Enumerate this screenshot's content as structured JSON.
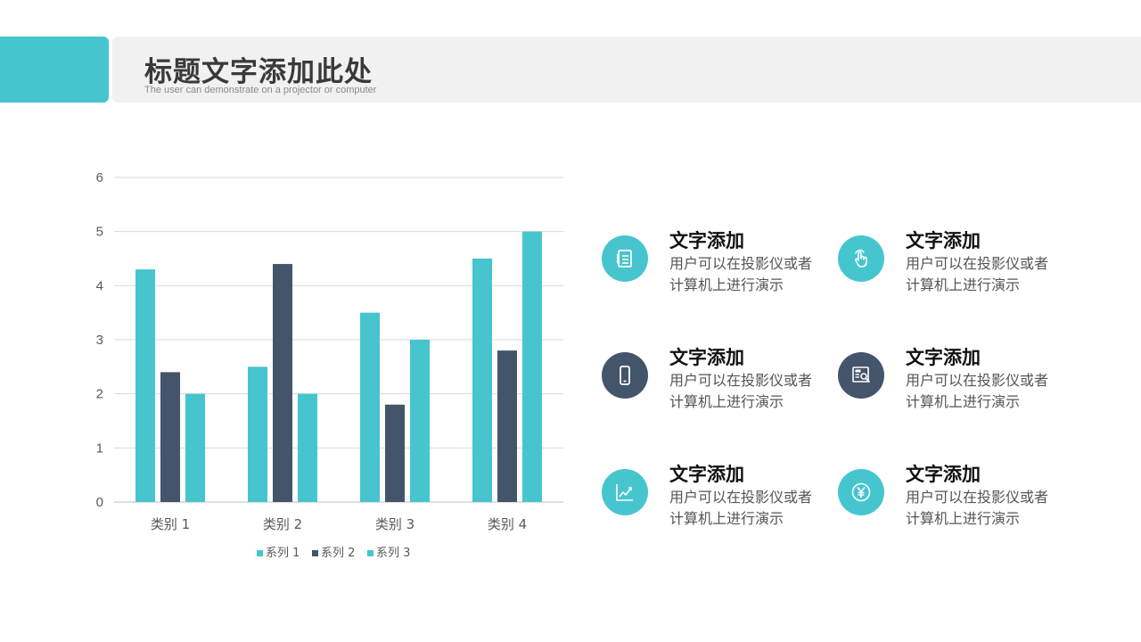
{
  "header": {
    "title": "标题文字添加此处",
    "subtitle": "The user can demonstrate on a projector or computer"
  },
  "colors": {
    "accent": "#47c5cf",
    "dark": "#44546a",
    "title_bar": "#f1f1f1"
  },
  "chart_data": {
    "type": "bar",
    "categories": [
      "类别 1",
      "类别 2",
      "类别 3",
      "类别 4"
    ],
    "series": [
      {
        "name": "系列 1",
        "values": [
          4.3,
          2.5,
          3.5,
          4.5
        ],
        "color": "#47c5cf"
      },
      {
        "name": "系列 2",
        "values": [
          2.4,
          4.4,
          1.8,
          2.8
        ],
        "color": "#44546a"
      },
      {
        "name": "系列 3",
        "values": [
          2,
          2,
          3,
          5
        ],
        "color": "#47c5cf"
      }
    ],
    "yticks": [
      "0",
      "1",
      "2",
      "3",
      "4",
      "5",
      "6"
    ],
    "ylim": [
      0,
      6
    ],
    "grid": true,
    "legend_position": "bottom"
  },
  "features": [
    {
      "title": "文字添加",
      "desc": "用户可以在投影仪或者计算机上进行演示",
      "icon": "document-icon",
      "color": "#47c5cf"
    },
    {
      "title": "文字添加",
      "desc": "用户可以在投影仪或者计算机上进行演示",
      "icon": "touch-icon",
      "color": "#47c5cf"
    },
    {
      "title": "文字添加",
      "desc": "用户可以在投影仪或者计算机上进行演示",
      "icon": "phone-icon",
      "color": "#44546a"
    },
    {
      "title": "文字添加",
      "desc": "用户可以在投影仪或者计算机上进行演示",
      "icon": "search-report-icon",
      "color": "#44546a"
    },
    {
      "title": "文字添加",
      "desc": "用户可以在投影仪或者计算机上进行演示",
      "icon": "trend-chart-icon",
      "color": "#47c5cf"
    },
    {
      "title": "文字添加",
      "desc": "用户可以在投影仪或者计算机上进行演示",
      "icon": "yen-icon",
      "color": "#47c5cf"
    }
  ]
}
